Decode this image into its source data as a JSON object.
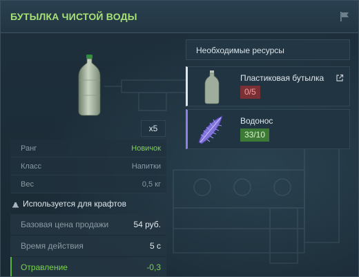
{
  "header": {
    "title": "БУТЫЛКА ЧИСТОЙ ВОДЫ",
    "flag_icon": "flag-icon"
  },
  "item": {
    "icon": "water-bottle-icon",
    "quantity": "x5"
  },
  "stats": [
    {
      "label": "Ранг",
      "value": "Новичок",
      "highlight": true
    },
    {
      "label": "Класс",
      "value": "Напитки",
      "highlight": false
    },
    {
      "label": "Вес",
      "value": "0,5 кг",
      "highlight": false
    }
  ],
  "crafting_note": {
    "icon": "crafting-icon",
    "text": "Используется для крафтов"
  },
  "properties": [
    {
      "label": "Базовая цена продажи",
      "value": "54 руб."
    },
    {
      "label": "Время действия",
      "value": "5 с"
    },
    {
      "label": "Отравление",
      "value": "-0,3"
    }
  ],
  "resources": {
    "heading": "Необходимые ресурсы",
    "items": [
      {
        "name": "Пластиковая бутылка",
        "count": "0/5",
        "status": "insufficient",
        "icon": "plastic-bottle-icon",
        "link_icon": "external-link-icon",
        "accent": "#dfe6ea"
      },
      {
        "name": "Водонос",
        "count": "33/10",
        "status": "sufficient",
        "icon": "vodonos-artifact-icon",
        "accent": "#8f7fe6"
      }
    ]
  },
  "colors": {
    "title": "#a6e274",
    "rank": "#7ad44d",
    "poison": "#7ad44d",
    "badge_red": "#7a3136",
    "badge_green": "#3c7a35"
  }
}
